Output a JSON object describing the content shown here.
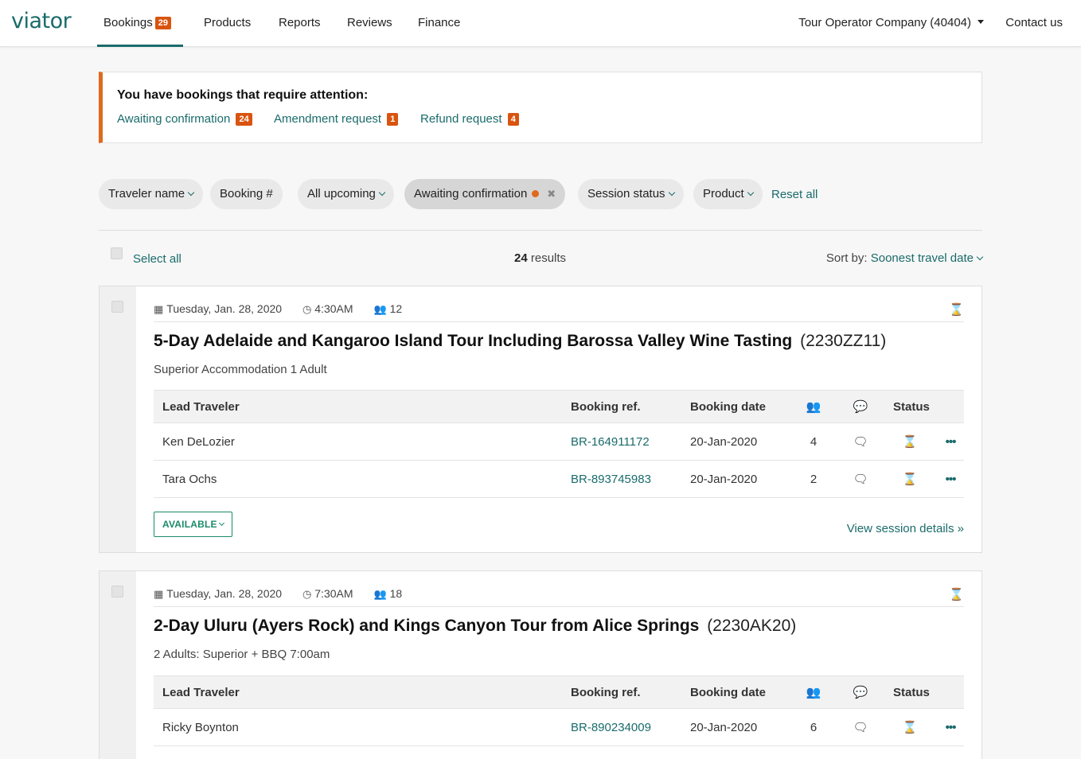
{
  "header": {
    "logo": "viator",
    "nav": [
      {
        "label": "Bookings",
        "badge": "29"
      },
      {
        "label": "Products"
      },
      {
        "label": "Reports"
      },
      {
        "label": "Reviews"
      },
      {
        "label": "Finance"
      }
    ],
    "company": "Tour Operator Company (40404)",
    "contact": "Contact us",
    "accent_color": "#1b6b6b"
  },
  "alert": {
    "title": "You have bookings that require attention:",
    "links": [
      {
        "label": "Awaiting confirmation",
        "count": "24"
      },
      {
        "label": "Amendment request",
        "count": "1"
      },
      {
        "label": "Refund request",
        "count": "4"
      }
    ],
    "accent_color": "#e06a1b"
  },
  "filters": {
    "chips": [
      {
        "label": "Traveler name"
      },
      {
        "label": "Booking #"
      },
      {
        "label": "All upcoming"
      },
      {
        "label": "Awaiting confirmation"
      },
      {
        "label": "Session status"
      },
      {
        "label": "Product"
      }
    ],
    "reset": "Reset all"
  },
  "results_bar": {
    "select_all": "Select all",
    "count": "24",
    "count_suffix": " results",
    "sort_label": "Sort by: ",
    "sort_value": "Soonest travel date"
  },
  "table_headers": {
    "lead": "Lead Traveler",
    "ref": "Booking ref.",
    "date": "Booking date",
    "status": "Status"
  },
  "cards": [
    {
      "date": "Tuesday, Jan. 28, 2020",
      "time": "4:30AM",
      "pax": "12",
      "title": "5-Day Adelaide and Kangaroo Island Tour Including Barossa Valley Wine Tasting",
      "code": "(2230ZZ11)",
      "option": "Superior Accommodation 1 Adult",
      "rows": [
        {
          "name": "Ken DeLozier",
          "ref": "BR-164911172",
          "date": "20-Jan-2020",
          "pax": "4"
        },
        {
          "name": "Tara Ochs",
          "ref": "BR-893745983",
          "date": "20-Jan-2020",
          "pax": "2"
        }
      ],
      "availability": "AVAILABLE",
      "session_link": "View session details"
    },
    {
      "date": "Tuesday, Jan. 28, 2020",
      "time": "7:30AM",
      "pax": "18",
      "title": "2-Day Uluru (Ayers Rock) and Kings Canyon Tour from Alice Springs",
      "code": "(2230AK20)",
      "option": "2 Adults: Superior + BBQ 7:00am",
      "rows": [
        {
          "name": "Ricky Boynton",
          "ref": "BR-890234009",
          "date": "20-Jan-2020",
          "pax": "6"
        }
      ]
    }
  ]
}
